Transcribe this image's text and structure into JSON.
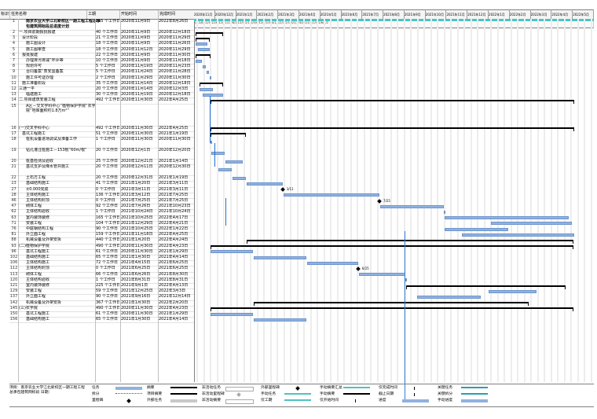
{
  "headers": {
    "id": "标识号",
    "name": "任务名称",
    "dur": "工期",
    "start": "开始时间",
    "end": "完成时间"
  },
  "timeline": {
    "months": [
      "2020年11月",
      "2020年12月",
      "2021年1月",
      "2021年2月",
      "2021年3月",
      "2021年4月",
      "2021年5月",
      "2021年6月",
      "2021年7月",
      "2021年8月",
      "2021年9月",
      "2021年10月",
      "2021年11月",
      "2021年12月",
      "2022年1月",
      "2022年2月",
      "2022年3月",
      "2022年4月",
      "2022年5月"
    ],
    "week_labels": "2/11/6/12/1/12/6/12/11/12/6/1/12/5/2/1/1/5/6/12/7/1/3/4/1/1/2/1/2/1/8/1/3/3/2/1/1/1/1/9/1/6/1/2"
  },
  "rows": [
    {
      "id": "1",
      "name": "南京农业大学江北新校区一期工程工程总承包建筑网标段总进度计划",
      "dur": "655 个工作日",
      "start": "2020年11月9日",
      "end": "2022年8月26日",
      "bold": true
    },
    {
      "id": "2",
      "name": "一.项目前期报批报建",
      "dur": "40 个工作日",
      "start": "2020年11月9日",
      "end": "2020年12月18日"
    },
    {
      "id": "3",
      "name": "设计阶段",
      "dur": "21 个工作日",
      "start": "2020年11月9日",
      "end": "2020年11月29日"
    },
    {
      "id": "4",
      "name": "施工图设计",
      "dur": "18 个工作日",
      "start": "2020年11月9日",
      "end": "2020年11月26日"
    },
    {
      "id": "5",
      "name": "施工图审查",
      "dur": "18 个工作日",
      "start": "2020年11月12日",
      "end": "2020年11月29日"
    },
    {
      "id": "6",
      "name": "报批报建",
      "dur": "22 个工作日",
      "start": "2020年11月9日",
      "end": "2020年11月30日"
    },
    {
      "id": "7",
      "name": "办理排污排减“环评等",
      "dur": "10 个工作日",
      "start": "2020年11月9日",
      "end": "2020年11月18日"
    },
    {
      "id": "8",
      "name": "规划许可",
      "dur": "5 个工作日",
      "start": "2020年11月19日",
      "end": "2020年11月23日"
    },
    {
      "id": "9",
      "name": "合同备案“质安监备案",
      "dur": "5 个工作日",
      "start": "2020年11月24日",
      "end": "2020年11月28日"
    },
    {
      "id": "10",
      "name": "施工许可证办理",
      "dur": "2 个工作日",
      "start": "2020年11月29日",
      "end": "2020年11月30日"
    },
    {
      "id": "11",
      "name": "施工准备阶段",
      "dur": "35 个工作日",
      "start": "2020年11月14日",
      "end": "2020年12月18日"
    },
    {
      "id": "12",
      "name": "三通一平",
      "dur": "20 个工作日",
      "start": "2020年11月14日",
      "end": "2020年12月3日"
    },
    {
      "id": "13",
      "name": "临建施工",
      "dur": "30 个工作日",
      "start": "2020年11月19日",
      "end": "2020年12月18日"
    },
    {
      "id": "14",
      "name": "二.项目建筑安装工程",
      "dur": "492 个工作日",
      "start": "2020年11月30日",
      "end": "2022年4月25日"
    },
    {
      "id": "15",
      "name": "A区－交叉学科中心“植物保护学院“农学院“地库面积约1.8万m²”",
      "dur": "",
      "start": "",
      "end": ""
    },
    {
      "id": "16",
      "name": "(一)交叉学科中心",
      "dur": "492 个工作日",
      "start": "2020年11月30日",
      "end": "2022年4月25日"
    },
    {
      "id": "17",
      "name": "基坑工程施工",
      "dur": "51 个工作日",
      "start": "2020年11月30日",
      "end": "2021年1月19日"
    },
    {
      "id": "18",
      "name": "桩机设备进场调试及准备工作",
      "dur": "1 个工作日",
      "start": "2020年11月30日",
      "end": "2020年11月30日"
    },
    {
      "id": "19",
      "name": "钻孔灌注桩施工－153根“60m/根”",
      "dur": "20 个工作日",
      "start": "2020年12月1日",
      "end": "2020年12月20日"
    },
    {
      "id": "20",
      "name": "桩基检测及验收",
      "dur": "25 个工作日",
      "start": "2020年12月21日",
      "end": "2021年1月14日"
    },
    {
      "id": "21",
      "name": "基坑支护及降水管井施工",
      "dur": "20 个工作日",
      "start": "2020年12月11日",
      "end": "2020年12月30日"
    },
    {
      "id": "22",
      "name": "土石方工程",
      "dur": "20 个工作日",
      "start": "2020年12月31日",
      "end": "2021年1月19日"
    },
    {
      "id": "23",
      "name": "基础结构施工",
      "dur": "41 个工作日",
      "start": "2021年1月20日",
      "end": "2021年3月11日"
    },
    {
      "id": "27",
      "name": "±0.000完成",
      "dur": "0 个工作日",
      "start": "2021年3月11日",
      "end": "2021年3月11日"
    },
    {
      "id": "28",
      "name": "主体结构施工",
      "dur": "136 个工作日",
      "start": "2021年3月12日",
      "end": "2021年7月25日"
    },
    {
      "id": "46",
      "name": "主体结构封顶",
      "dur": "0 个工作日",
      "start": "2021年7月25日",
      "end": "2021年7月25日"
    },
    {
      "id": "47",
      "name": "砌体工程",
      "dur": "92 个工作日",
      "start": "2021年7月26日",
      "end": "2021年10月23日"
    },
    {
      "id": "62",
      "name": "主体结构验收",
      "dur": "1 个工作日",
      "start": "2021年10月24日",
      "end": "2021年10月24日"
    },
    {
      "id": "63",
      "name": "室内装饰装修",
      "dur": "165 个工作日",
      "start": "2021年10月25日",
      "end": "2022年4月17日"
    },
    {
      "id": "71",
      "name": "安装工程",
      "dur": "104 个工作日",
      "start": "2021年12月29日",
      "end": "2022年4月21日"
    },
    {
      "id": "76",
      "name": "中庭钢结构工程",
      "dur": "90 个工作日",
      "start": "2021年10月25日",
      "end": "2022年1月22日"
    },
    {
      "id": "81",
      "name": "外立面工程",
      "dur": "159 个工作日",
      "start": "2021年11月18日",
      "end": "2022年4月25日"
    },
    {
      "id": "88",
      "name": "机械设备及外架安拆",
      "dur": "440 个工作日",
      "start": "2021年1月20日",
      "end": "2022年4月24日"
    },
    {
      "id": "93",
      "name": "(二)植物保护学院",
      "dur": "490 个工作日",
      "start": "2020年11月30日",
      "end": "2022年4月23日"
    },
    {
      "id": "96",
      "name": "基坑工程施工",
      "dur": "61 个工作日",
      "start": "2020年11月30日",
      "end": "2021年1月29日"
    },
    {
      "id": "102",
      "name": "基础结构施工",
      "dur": "65 个工作日",
      "start": "2021年1月30日",
      "end": "2021年4月14日"
    },
    {
      "id": "106",
      "name": "主体结构施工",
      "dur": "72 个工作日",
      "start": "2021年4月15日",
      "end": "2021年6月25日"
    },
    {
      "id": "112",
      "name": "主体结构封顶",
      "dur": "0 个工作日",
      "start": "2021年6月25日",
      "end": "2021年6月25日"
    },
    {
      "id": "113",
      "name": "砌体工程",
      "dur": "66 个工作日",
      "start": "2021年6月26日",
      "end": "2021年8月30日"
    },
    {
      "id": "120",
      "name": "主体结构验收",
      "dur": "1 个工作日",
      "start": "2021年8月31日",
      "end": "2021年8月31日"
    },
    {
      "id": "121",
      "name": "室内装饰装修",
      "dur": "225 个工作日",
      "start": "2021年9月1日",
      "end": "2022年4月13日"
    },
    {
      "id": "129",
      "name": "安装工程",
      "dur": "59 个工作日",
      "start": "2021年12月25日",
      "end": "2022年3月3日"
    },
    {
      "id": "137",
      "name": "外立面工程",
      "dur": "90 个工作日",
      "start": "2021年9月16日",
      "end": "2021年12月14日"
    },
    {
      "id": "142",
      "name": "机械设备及外架安拆",
      "dur": "367 个工作日",
      "start": "2021年1月30日",
      "end": "2022年2月20日"
    },
    {
      "id": "145",
      "name": "(三)农学院",
      "dur": "490 个工作日",
      "start": "2020年11月30日",
      "end": "2022年4月23日"
    },
    {
      "id": "150",
      "name": "基坑工程施工",
      "dur": "61 个工作日",
      "start": "2020年11月30日",
      "end": "2021年1月29日"
    },
    {
      "id": "156",
      "name": "基础结构施工",
      "dur": "65 个工作日",
      "start": "2021年1月30日",
      "end": "2021年4月14日"
    }
  ],
  "milestone_labels": {
    "m27": "3/11",
    "m46": "7/25",
    "m112": "6/25"
  },
  "footer": {
    "project": "项目：南京农业大学江北新校区一期工程工程总承包建筑网标段",
    "date_label": "日期：",
    "legend": {
      "task": "任务",
      "split": "拆分",
      "milestone": "里程碑",
      "summary": "摘要",
      "project_summary": "项目摘要",
      "external_tasks": "外部任务",
      "inactive_task": "非活动任务",
      "inactive_milestone": "非活动里程碑",
      "inactive_summary": "非活动摘要",
      "external_milestone": "外部里程碑",
      "manual_task": "手动任务",
      "manual_only": "仅工期",
      "manual_summary_rollup": "手动摘要汇总",
      "manual_summary": "手动摘要",
      "start_only": "仅开始时间",
      "finish_only": "仅完成时间",
      "deadline": "截止日期",
      "progress": "进度",
      "critical": "关键任务",
      "critical_split": "关键拆分",
      "manual_progress": "手动进度"
    }
  },
  "colors": {
    "bar": "#8fb2e0",
    "summary": "#000000",
    "today": "#2f7fe0",
    "link": "#1f6fd1",
    "top": "#4ec3c1"
  }
}
